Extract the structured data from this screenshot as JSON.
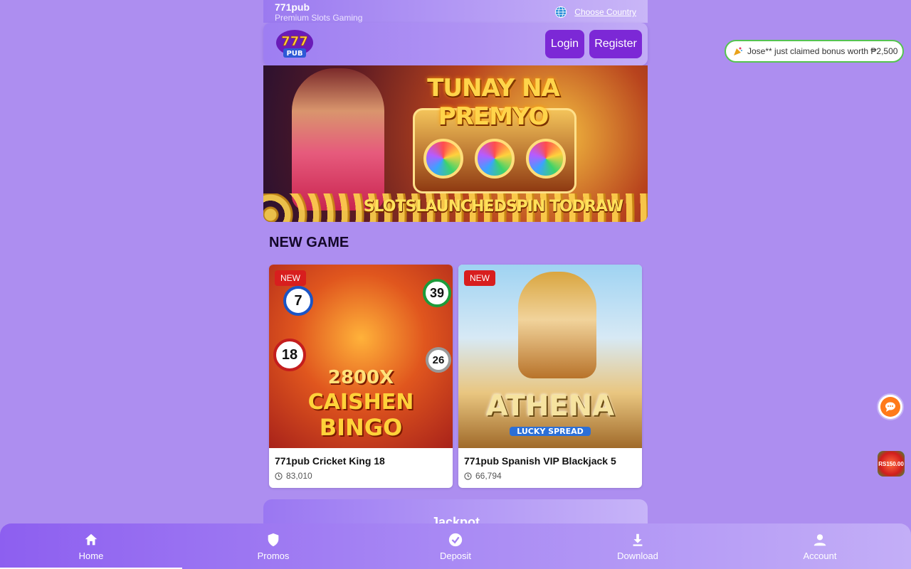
{
  "topbar": {
    "brand": "771pub",
    "tagline": "Premium Slots Gaming",
    "country_link": "Choose Country"
  },
  "header": {
    "logo_text": "777 PUB",
    "login_label": "Login",
    "register_label": "Register"
  },
  "banner": {
    "title": "TUNAY NA PREMYO",
    "subtitle": "SLOTSLAUNCHEDSPIN TODRAW"
  },
  "section": {
    "title": "NEW GAME"
  },
  "games": [
    {
      "badge": "NEW",
      "art_line1": "2800X",
      "art_line2": "CAISHEN",
      "art_line3": "BINGO",
      "name": "771pub Cricket King 18",
      "plays": "83,010"
    },
    {
      "badge": "NEW",
      "art_line1": "ATHENA",
      "art_line2": "LUCKY SPREAD",
      "name": "771pub Spanish VIP Blackjack 5",
      "plays": "66,794"
    }
  ],
  "jackpot": {
    "label": "Jackpot"
  },
  "toast": {
    "text": "Jose** just claimed bonus worth ₱2,500"
  },
  "float_promo": {
    "text": "RS150.00"
  },
  "bottom_nav": [
    {
      "label": "Home",
      "icon": "home-icon"
    },
    {
      "label": "Promos",
      "icon": "shield-icon"
    },
    {
      "label": "Deposit",
      "icon": "check-circle-icon"
    },
    {
      "label": "Download",
      "icon": "download-icon"
    },
    {
      "label": "Account",
      "icon": "user-icon"
    }
  ],
  "colors": {
    "primary_button": "#7c28d6",
    "background": "#ad8ef0",
    "badge": "#d81e1e",
    "toast_border": "#55c450"
  }
}
